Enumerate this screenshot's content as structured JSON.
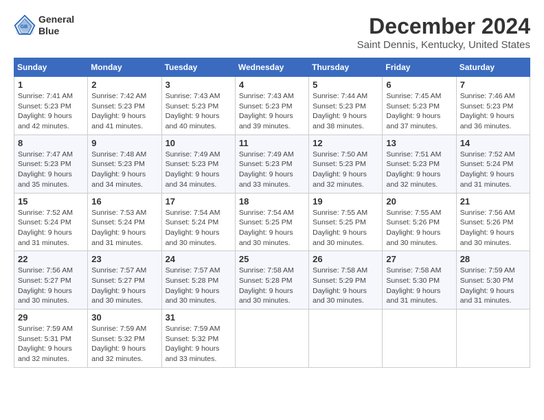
{
  "logo": {
    "line1": "General",
    "line2": "Blue"
  },
  "title": "December 2024",
  "subtitle": "Saint Dennis, Kentucky, United States",
  "header_color": "#3a6bbf",
  "days_of_week": [
    "Sunday",
    "Monday",
    "Tuesday",
    "Wednesday",
    "Thursday",
    "Friday",
    "Saturday"
  ],
  "weeks": [
    [
      {
        "day": "1",
        "sunrise": "7:41 AM",
        "sunset": "5:23 PM",
        "daylight": "9 hours and 42 minutes."
      },
      {
        "day": "2",
        "sunrise": "7:42 AM",
        "sunset": "5:23 PM",
        "daylight": "9 hours and 41 minutes."
      },
      {
        "day": "3",
        "sunrise": "7:43 AM",
        "sunset": "5:23 PM",
        "daylight": "9 hours and 40 minutes."
      },
      {
        "day": "4",
        "sunrise": "7:43 AM",
        "sunset": "5:23 PM",
        "daylight": "9 hours and 39 minutes."
      },
      {
        "day": "5",
        "sunrise": "7:44 AM",
        "sunset": "5:23 PM",
        "daylight": "9 hours and 38 minutes."
      },
      {
        "day": "6",
        "sunrise": "7:45 AM",
        "sunset": "5:23 PM",
        "daylight": "9 hours and 37 minutes."
      },
      {
        "day": "7",
        "sunrise": "7:46 AM",
        "sunset": "5:23 PM",
        "daylight": "9 hours and 36 minutes."
      }
    ],
    [
      {
        "day": "8",
        "sunrise": "7:47 AM",
        "sunset": "5:23 PM",
        "daylight": "9 hours and 35 minutes."
      },
      {
        "day": "9",
        "sunrise": "7:48 AM",
        "sunset": "5:23 PM",
        "daylight": "9 hours and 34 minutes."
      },
      {
        "day": "10",
        "sunrise": "7:49 AM",
        "sunset": "5:23 PM",
        "daylight": "9 hours and 34 minutes."
      },
      {
        "day": "11",
        "sunrise": "7:49 AM",
        "sunset": "5:23 PM",
        "daylight": "9 hours and 33 minutes."
      },
      {
        "day": "12",
        "sunrise": "7:50 AM",
        "sunset": "5:23 PM",
        "daylight": "9 hours and 32 minutes."
      },
      {
        "day": "13",
        "sunrise": "7:51 AM",
        "sunset": "5:23 PM",
        "daylight": "9 hours and 32 minutes."
      },
      {
        "day": "14",
        "sunrise": "7:52 AM",
        "sunset": "5:24 PM",
        "daylight": "9 hours and 31 minutes."
      }
    ],
    [
      {
        "day": "15",
        "sunrise": "7:52 AM",
        "sunset": "5:24 PM",
        "daylight": "9 hours and 31 minutes."
      },
      {
        "day": "16",
        "sunrise": "7:53 AM",
        "sunset": "5:24 PM",
        "daylight": "9 hours and 31 minutes."
      },
      {
        "day": "17",
        "sunrise": "7:54 AM",
        "sunset": "5:24 PM",
        "daylight": "9 hours and 30 minutes."
      },
      {
        "day": "18",
        "sunrise": "7:54 AM",
        "sunset": "5:25 PM",
        "daylight": "9 hours and 30 minutes."
      },
      {
        "day": "19",
        "sunrise": "7:55 AM",
        "sunset": "5:25 PM",
        "daylight": "9 hours and 30 minutes."
      },
      {
        "day": "20",
        "sunrise": "7:55 AM",
        "sunset": "5:26 PM",
        "daylight": "9 hours and 30 minutes."
      },
      {
        "day": "21",
        "sunrise": "7:56 AM",
        "sunset": "5:26 PM",
        "daylight": "9 hours and 30 minutes."
      }
    ],
    [
      {
        "day": "22",
        "sunrise": "7:56 AM",
        "sunset": "5:27 PM",
        "daylight": "9 hours and 30 minutes."
      },
      {
        "day": "23",
        "sunrise": "7:57 AM",
        "sunset": "5:27 PM",
        "daylight": "9 hours and 30 minutes."
      },
      {
        "day": "24",
        "sunrise": "7:57 AM",
        "sunset": "5:28 PM",
        "daylight": "9 hours and 30 minutes."
      },
      {
        "day": "25",
        "sunrise": "7:58 AM",
        "sunset": "5:28 PM",
        "daylight": "9 hours and 30 minutes."
      },
      {
        "day": "26",
        "sunrise": "7:58 AM",
        "sunset": "5:29 PM",
        "daylight": "9 hours and 30 minutes."
      },
      {
        "day": "27",
        "sunrise": "7:58 AM",
        "sunset": "5:30 PM",
        "daylight": "9 hours and 31 minutes."
      },
      {
        "day": "28",
        "sunrise": "7:59 AM",
        "sunset": "5:30 PM",
        "daylight": "9 hours and 31 minutes."
      }
    ],
    [
      {
        "day": "29",
        "sunrise": "7:59 AM",
        "sunset": "5:31 PM",
        "daylight": "9 hours and 32 minutes."
      },
      {
        "day": "30",
        "sunrise": "7:59 AM",
        "sunset": "5:32 PM",
        "daylight": "9 hours and 32 minutes."
      },
      {
        "day": "31",
        "sunrise": "7:59 AM",
        "sunset": "5:32 PM",
        "daylight": "9 hours and 33 minutes."
      },
      null,
      null,
      null,
      null
    ]
  ]
}
